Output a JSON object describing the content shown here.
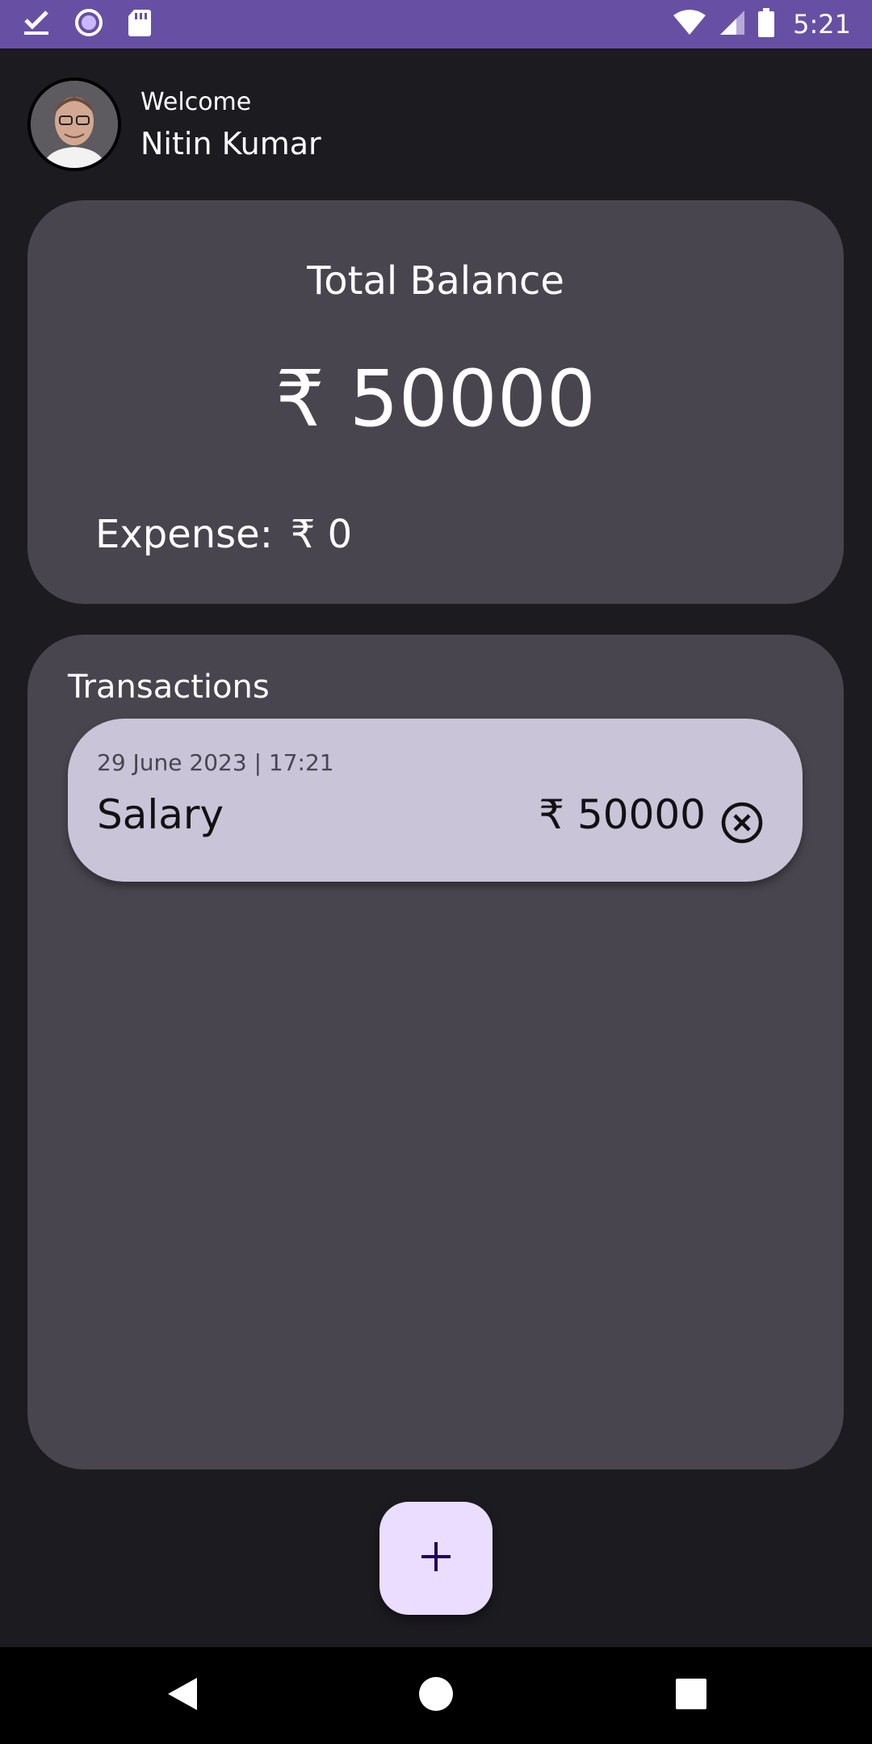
{
  "status_bar": {
    "time": "5:21",
    "left_icons": [
      "check-download-icon",
      "circle-app-icon",
      "sd-card-icon"
    ],
    "right_icons": [
      "wifi-icon",
      "cell-signal-icon",
      "battery-icon"
    ],
    "color": "#6750a4"
  },
  "header": {
    "welcome": "Welcome",
    "user_name": "Nitin Kumar"
  },
  "balance": {
    "title": "Total Balance",
    "amount": "₹ 50000",
    "expense_label": "Expense:",
    "expense_value": "₹ 0"
  },
  "transactions": {
    "title": "Transactions",
    "items": [
      {
        "date": "29 June 2023 | 17:21",
        "name": "Salary",
        "amount": "₹ 50000"
      }
    ]
  },
  "fab": {
    "icon": "plus-icon"
  },
  "nav_bar": {
    "buttons": [
      "back-icon",
      "home-icon",
      "recents-icon"
    ]
  },
  "colors": {
    "background": "#1c1b20",
    "card": "#49454f",
    "transaction_item": "#cac4d9",
    "fab": "#eaddff",
    "accent": "#6750a4"
  }
}
